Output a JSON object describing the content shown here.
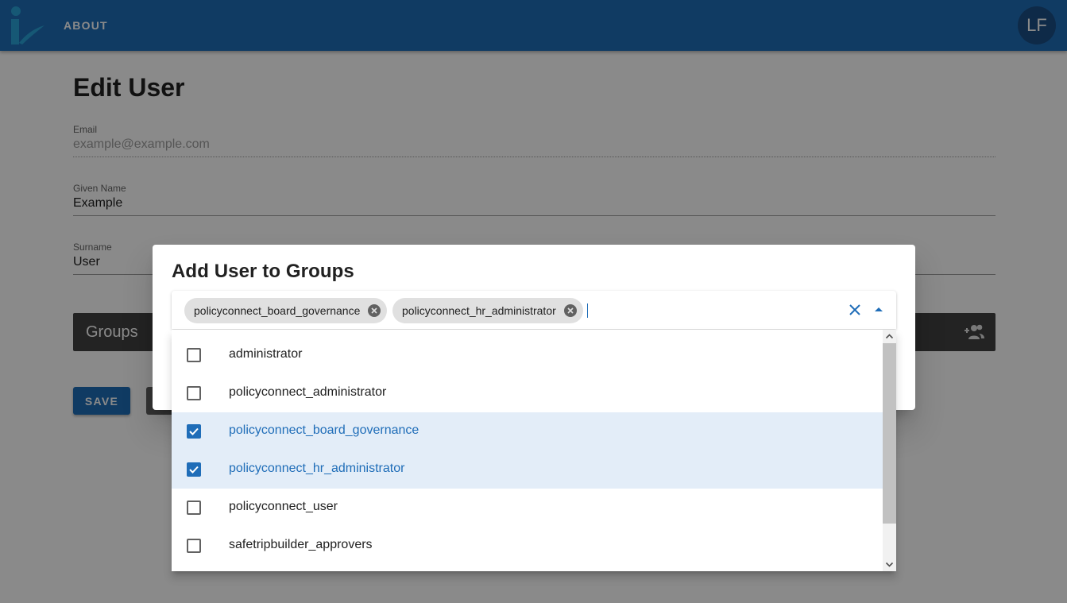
{
  "app": {
    "logo_icon": "iv-logo-icon",
    "nav_about": "ABOUT",
    "avatar_initials": "LF",
    "brand_color": "#1f6db8"
  },
  "page": {
    "title": "Edit User",
    "email_label": "Email",
    "email_value": "example@example.com",
    "given_label": "Given Name",
    "given_value": "Example",
    "surname_label": "Surname",
    "surname_value": "User",
    "groups_title": "Groups",
    "add_group_icon": "group-add-icon",
    "save_label": "SAVE"
  },
  "dialog": {
    "title": "Add User to Groups",
    "chips": [
      {
        "label": "policyconnect_board_governance"
      },
      {
        "label": "policyconnect_hr_administrator"
      }
    ],
    "clear_icon": "close-icon",
    "menu_icon": "caret-up-icon",
    "options": [
      {
        "label": "administrator",
        "checked": false
      },
      {
        "label": "policyconnect_administrator",
        "checked": false
      },
      {
        "label": "policyconnect_board_governance",
        "checked": true
      },
      {
        "label": "policyconnect_hr_administrator",
        "checked": true
      },
      {
        "label": "policyconnect_user",
        "checked": false
      },
      {
        "label": "safetripbuilder_approvers",
        "checked": false
      }
    ]
  }
}
